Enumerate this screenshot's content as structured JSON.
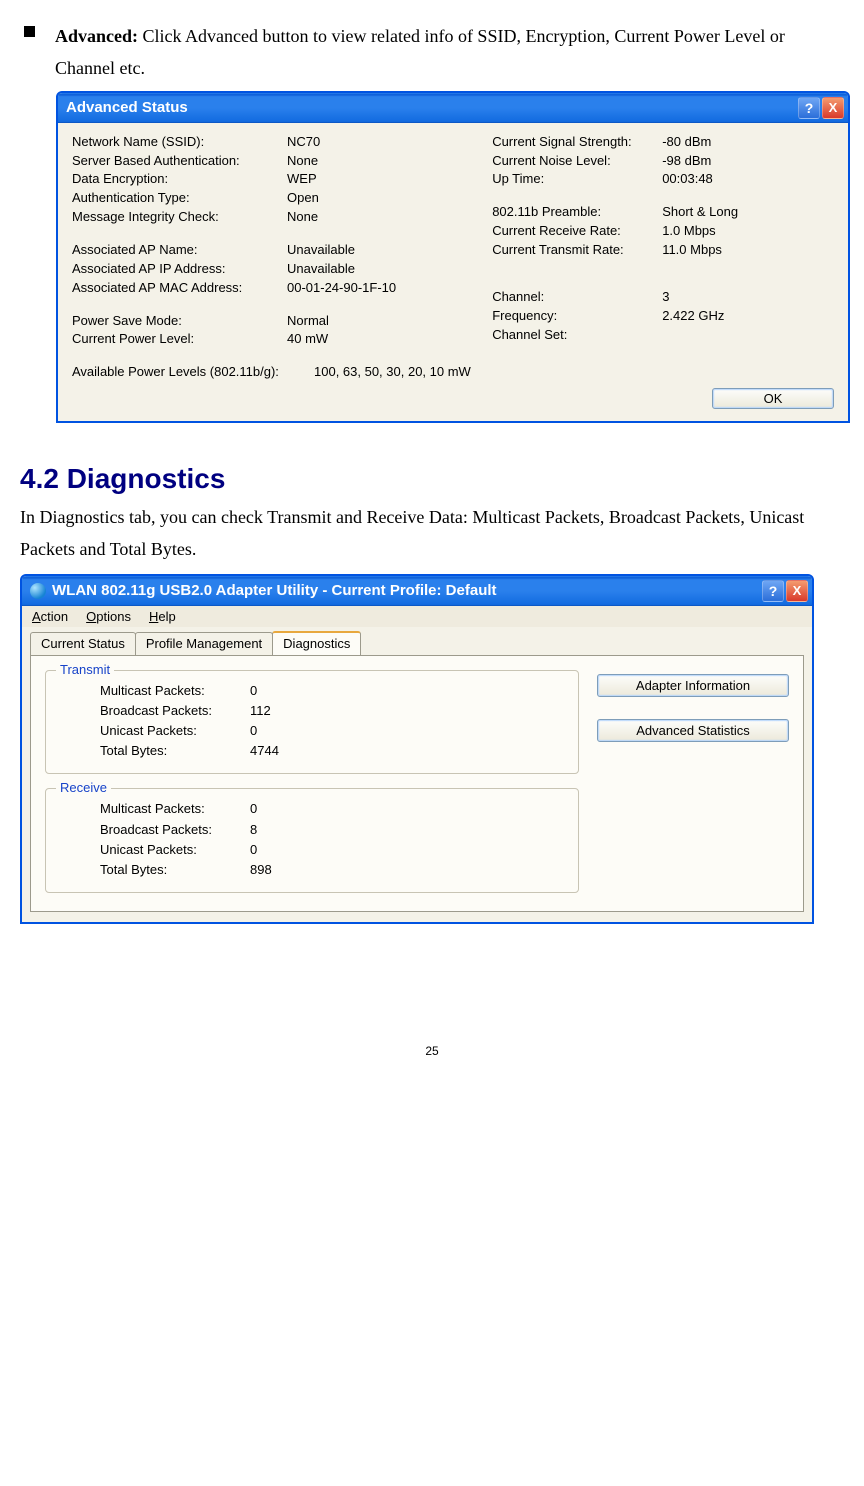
{
  "bullet": {
    "label": "Advanced:",
    "text": " Click Advanced button to view related info of SSID, Encryption, Current Power Level or Channel etc."
  },
  "advWindow": {
    "title": "Advanced Status",
    "help": "?",
    "close": "X",
    "left": {
      "ssid_l": "Network Name (SSID):",
      "ssid_v": "NC70",
      "auth_l": "Server Based Authentication:",
      "auth_v": "None",
      "enc_l": "Data Encryption:",
      "enc_v": "WEP",
      "atype_l": "Authentication Type:",
      "atype_v": "Open",
      "mic_l": "Message Integrity Check:",
      "mic_v": "None",
      "apn_l": "Associated AP Name:",
      "apn_v": "Unavailable",
      "apip_l": "Associated AP IP Address:",
      "apip_v": "Unavailable",
      "apmac_l": "Associated AP MAC Address:",
      "apmac_v": "00-01-24-90-1F-10",
      "psm_l": "Power Save Mode:",
      "psm_v": "Normal",
      "cpl_l": "Current Power Level:",
      "cpl_v": "40 mW",
      "apl_l": "Available Power Levels (802.11b/g):",
      "apl_v": "100, 63, 50, 30, 20, 10 mW"
    },
    "right": {
      "sig_l": "Current Signal Strength:",
      "sig_v": "-80 dBm",
      "noise_l": "Current Noise Level:",
      "noise_v": "-98 dBm",
      "up_l": "Up Time:",
      "up_v": "00:03:48",
      "pre_l": "802.11b Preamble:",
      "pre_v": "Short & Long",
      "rx_l": "Current Receive Rate:",
      "rx_v": "1.0 Mbps",
      "tx_l": "Current Transmit Rate:",
      "tx_v": "11.0 Mbps",
      "ch_l": "Channel:",
      "ch_v": "3",
      "freq_l": "Frequency:",
      "freq_v": "2.422 GHz",
      "cset_l": "Channel Set:",
      "cset_v": ""
    },
    "ok": "OK"
  },
  "section": {
    "heading": "4.2 Diagnostics",
    "paragraph": "In Diagnostics tab, you can check Transmit and Receive Data: Multicast Packets, Broadcast Packets, Unicast Packets and Total Bytes."
  },
  "diagWindow": {
    "title": "WLAN 802.11g USB2.0 Adapter Utility - Current Profile: Default",
    "help": "?",
    "close": "X",
    "menu": {
      "action": "Action",
      "options": "Options",
      "help": "Help"
    },
    "tabs": {
      "status": "Current Status",
      "profile": "Profile Management",
      "diag": "Diagnostics"
    },
    "transmit": {
      "legend": "Transmit",
      "multi_l": "Multicast Packets:",
      "multi_v": "0",
      "broad_l": "Broadcast Packets:",
      "broad_v": "112",
      "uni_l": "Unicast Packets:",
      "uni_v": "0",
      "total_l": "Total Bytes:",
      "total_v": "4744"
    },
    "receive": {
      "legend": "Receive",
      "multi_l": "Multicast Packets:",
      "multi_v": "0",
      "broad_l": "Broadcast Packets:",
      "broad_v": "8",
      "uni_l": "Unicast Packets:",
      "uni_v": "0",
      "total_l": "Total Bytes:",
      "total_v": "898"
    },
    "buttons": {
      "adapter": "Adapter Information",
      "advstats": "Advanced Statistics"
    }
  },
  "pageNumber": "25"
}
